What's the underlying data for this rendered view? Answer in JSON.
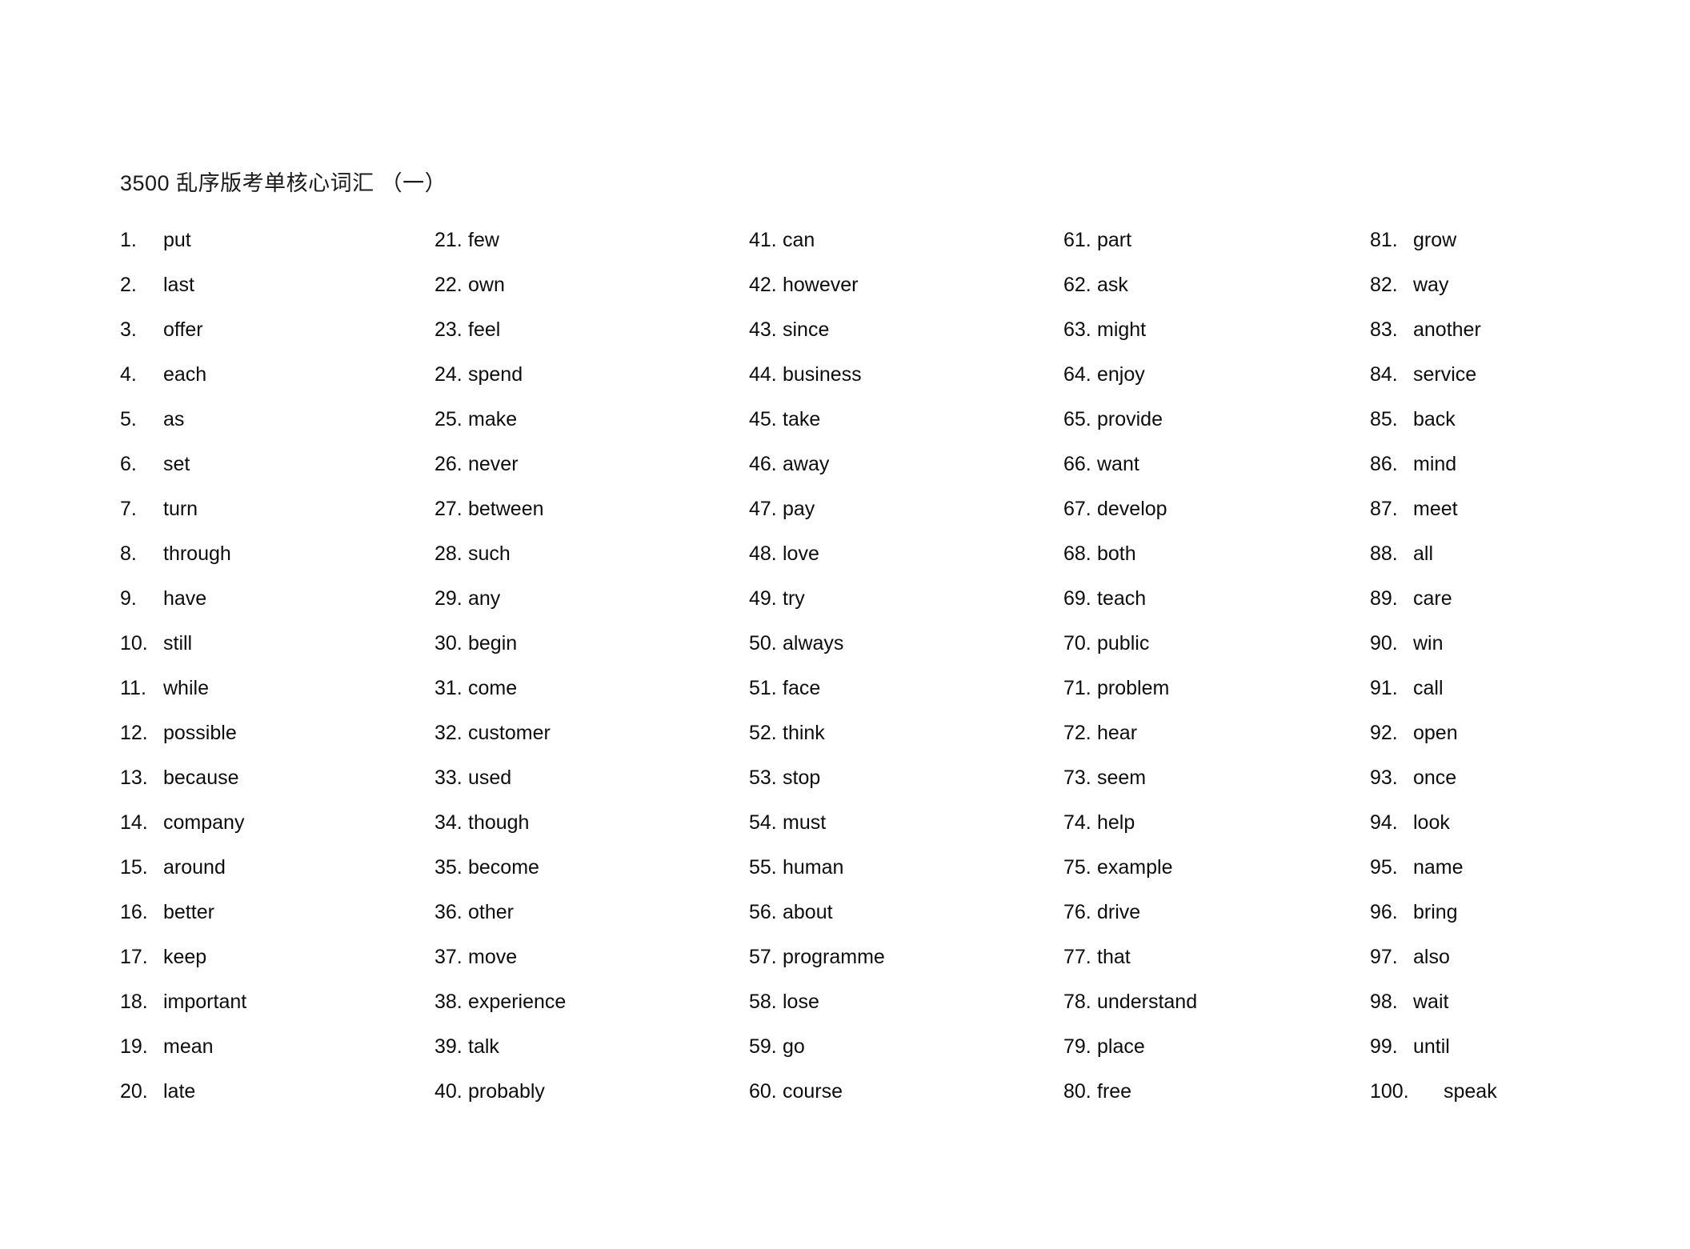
{
  "document": {
    "title": "3500 乱序版考单核心词汇 （一）"
  },
  "columns": [
    {
      "id": "column-1",
      "items": [
        {
          "num": "1.",
          "word": "put"
        },
        {
          "num": "2.",
          "word": "last"
        },
        {
          "num": "3.",
          "word": "offer"
        },
        {
          "num": "4.",
          "word": "each"
        },
        {
          "num": "5.",
          "word": "as"
        },
        {
          "num": "6.",
          "word": "set"
        },
        {
          "num": "7.",
          "word": "turn"
        },
        {
          "num": "8.",
          "word": "through"
        },
        {
          "num": "9.",
          "word": "have"
        },
        {
          "num": "10.",
          "word": "still"
        },
        {
          "num": "11.",
          "word": "while"
        },
        {
          "num": "12.",
          "word": "possible"
        },
        {
          "num": "13.",
          "word": "because"
        },
        {
          "num": "14.",
          "word": "company"
        },
        {
          "num": "15.",
          "word": "around"
        },
        {
          "num": "16.",
          "word": "better"
        },
        {
          "num": "17.",
          "word": "keep"
        },
        {
          "num": "18.",
          "word": "important"
        },
        {
          "num": "19.",
          "word": "mean"
        },
        {
          "num": "20.",
          "word": "late"
        }
      ]
    },
    {
      "id": "column-2",
      "items": [
        {
          "num": "21.",
          "word": "few"
        },
        {
          "num": "22.",
          "word": "own"
        },
        {
          "num": "23.",
          "word": "feel"
        },
        {
          "num": "24.",
          "word": "spend"
        },
        {
          "num": "25.",
          "word": "make"
        },
        {
          "num": "26.",
          "word": "never"
        },
        {
          "num": "27.",
          "word": "between"
        },
        {
          "num": "28.",
          "word": "such"
        },
        {
          "num": "29.",
          "word": "any"
        },
        {
          "num": "30.",
          "word": "begin"
        },
        {
          "num": "31.",
          "word": "come"
        },
        {
          "num": "32.",
          "word": "customer"
        },
        {
          "num": "33.",
          "word": "used"
        },
        {
          "num": "34.",
          "word": "though"
        },
        {
          "num": "35.",
          "word": "become"
        },
        {
          "num": "36.",
          "word": "other"
        },
        {
          "num": "37.",
          "word": "move"
        },
        {
          "num": "38.",
          "word": "experience"
        },
        {
          "num": "39.",
          "word": "talk"
        },
        {
          "num": "40.",
          "word": "probably"
        }
      ]
    },
    {
      "id": "column-3",
      "items": [
        {
          "num": "41.",
          "word": "can"
        },
        {
          "num": "42.",
          "word": "however"
        },
        {
          "num": "43.",
          "word": "since"
        },
        {
          "num": "44.",
          "word": "business"
        },
        {
          "num": "45.",
          "word": "take"
        },
        {
          "num": "46.",
          "word": "away"
        },
        {
          "num": "47.",
          "word": "pay"
        },
        {
          "num": "48.",
          "word": "love"
        },
        {
          "num": "49.",
          "word": "try"
        },
        {
          "num": "50.",
          "word": "always"
        },
        {
          "num": "51.",
          "word": "face"
        },
        {
          "num": "52.",
          "word": "think"
        },
        {
          "num": "53.",
          "word": "stop"
        },
        {
          "num": "54.",
          "word": "must"
        },
        {
          "num": "55.",
          "word": "human"
        },
        {
          "num": "56.",
          "word": "about"
        },
        {
          "num": "57.",
          "word": "programme"
        },
        {
          "num": "58.",
          "word": "lose"
        },
        {
          "num": "59.",
          "word": "go"
        },
        {
          "num": "60.",
          "word": "course"
        }
      ]
    },
    {
      "id": "column-4",
      "items": [
        {
          "num": "61.",
          "word": "part"
        },
        {
          "num": "62.",
          "word": "ask"
        },
        {
          "num": "63.",
          "word": "might"
        },
        {
          "num": "64.",
          "word": "enjoy"
        },
        {
          "num": "65.",
          "word": "provide"
        },
        {
          "num": "66.",
          "word": "want"
        },
        {
          "num": "67.",
          "word": "develop"
        },
        {
          "num": "68.",
          "word": "both"
        },
        {
          "num": "69.",
          "word": "teach"
        },
        {
          "num": "70.",
          "word": "public"
        },
        {
          "num": "71.",
          "word": "problem"
        },
        {
          "num": "72.",
          "word": "hear"
        },
        {
          "num": "73.",
          "word": "seem"
        },
        {
          "num": "74.",
          "word": "help"
        },
        {
          "num": "75.",
          "word": "example"
        },
        {
          "num": "76.",
          "word": "drive"
        },
        {
          "num": "77.",
          "word": "that"
        },
        {
          "num": "78.",
          "word": "understand"
        },
        {
          "num": "79.",
          "word": "place"
        },
        {
          "num": "80.",
          "word": "free"
        }
      ]
    },
    {
      "id": "column-5",
      "items": [
        {
          "num": "81.",
          "word": "grow"
        },
        {
          "num": "82.",
          "word": "way"
        },
        {
          "num": "83.",
          "word": "another"
        },
        {
          "num": "84.",
          "word": "service"
        },
        {
          "num": "85.",
          "word": "back"
        },
        {
          "num": "86.",
          "word": "mind"
        },
        {
          "num": "87.",
          "word": "meet"
        },
        {
          "num": "88.",
          "word": "all"
        },
        {
          "num": "89.",
          "word": "care"
        },
        {
          "num": "90.",
          "word": "win"
        },
        {
          "num": "91.",
          "word": "call"
        },
        {
          "num": "92.",
          "word": "open"
        },
        {
          "num": "93.",
          "word": "once"
        },
        {
          "num": "94.",
          "word": "look"
        },
        {
          "num": "95.",
          "word": "name"
        },
        {
          "num": "96.",
          "word": "bring"
        },
        {
          "num": "97.",
          "word": "also"
        },
        {
          "num": "98.",
          "word": "wait"
        },
        {
          "num": "99.",
          "word": "until"
        },
        {
          "num": "100.",
          "word": "speak",
          "wide_gap": true
        }
      ]
    }
  ]
}
